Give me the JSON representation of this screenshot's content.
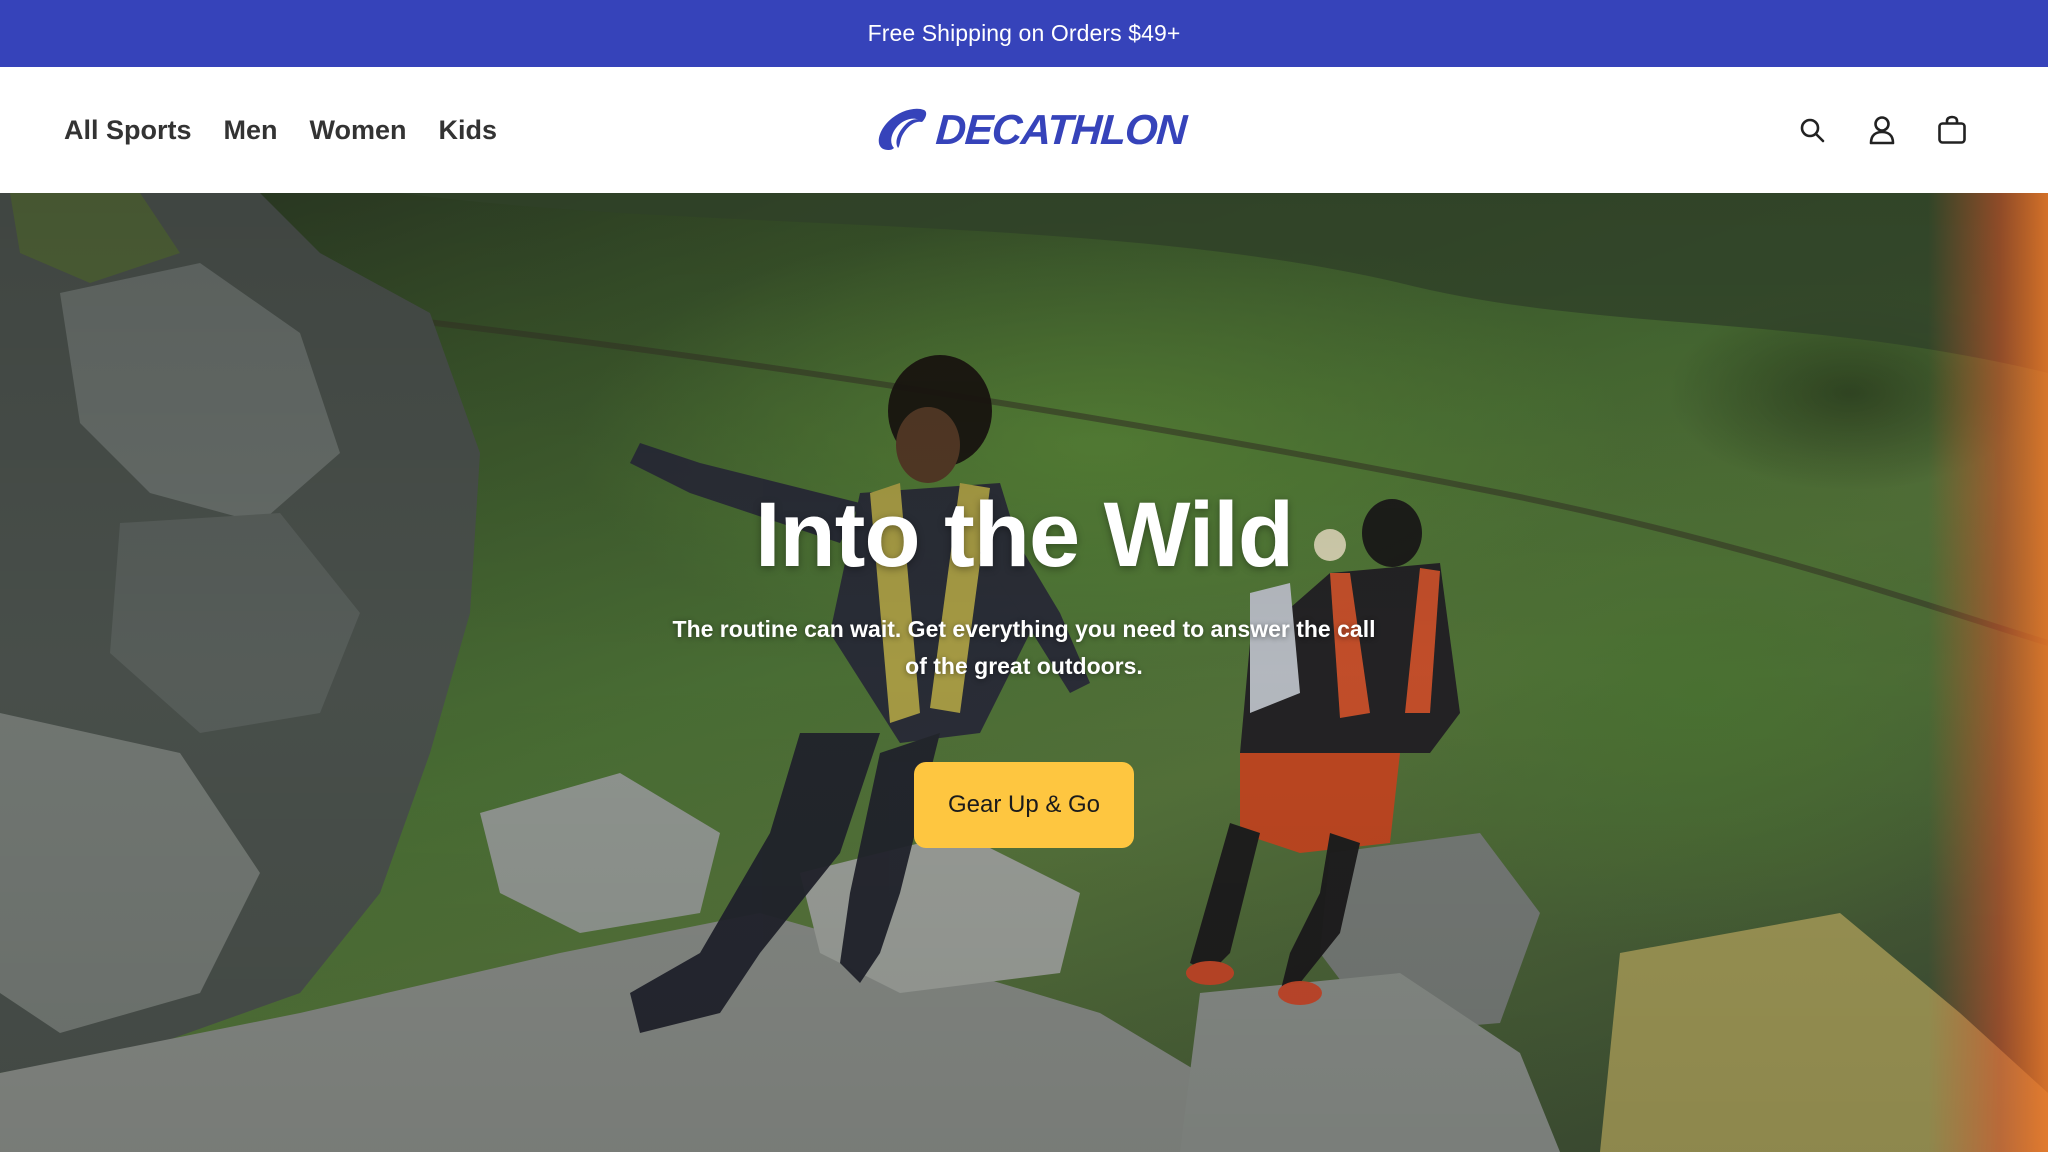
{
  "promo": {
    "text": "Free Shipping on Orders $49+"
  },
  "nav": {
    "items": [
      {
        "label": "All Sports"
      },
      {
        "label": "Men"
      },
      {
        "label": "Women"
      },
      {
        "label": "Kids"
      }
    ]
  },
  "logo": {
    "text": "DECATHLON"
  },
  "header_icons": {
    "search": "search-icon",
    "account": "user-icon",
    "cart": "shopping-bag-icon"
  },
  "hero": {
    "title": "Into the Wild",
    "subtitle": "The routine can wait. Get everything you need to answer the call of the great outdoors.",
    "cta_label": "Gear Up & Go"
  },
  "colors": {
    "brand_blue": "#3643ba",
    "cta_yellow": "#fec640",
    "nav_text": "#333333"
  }
}
